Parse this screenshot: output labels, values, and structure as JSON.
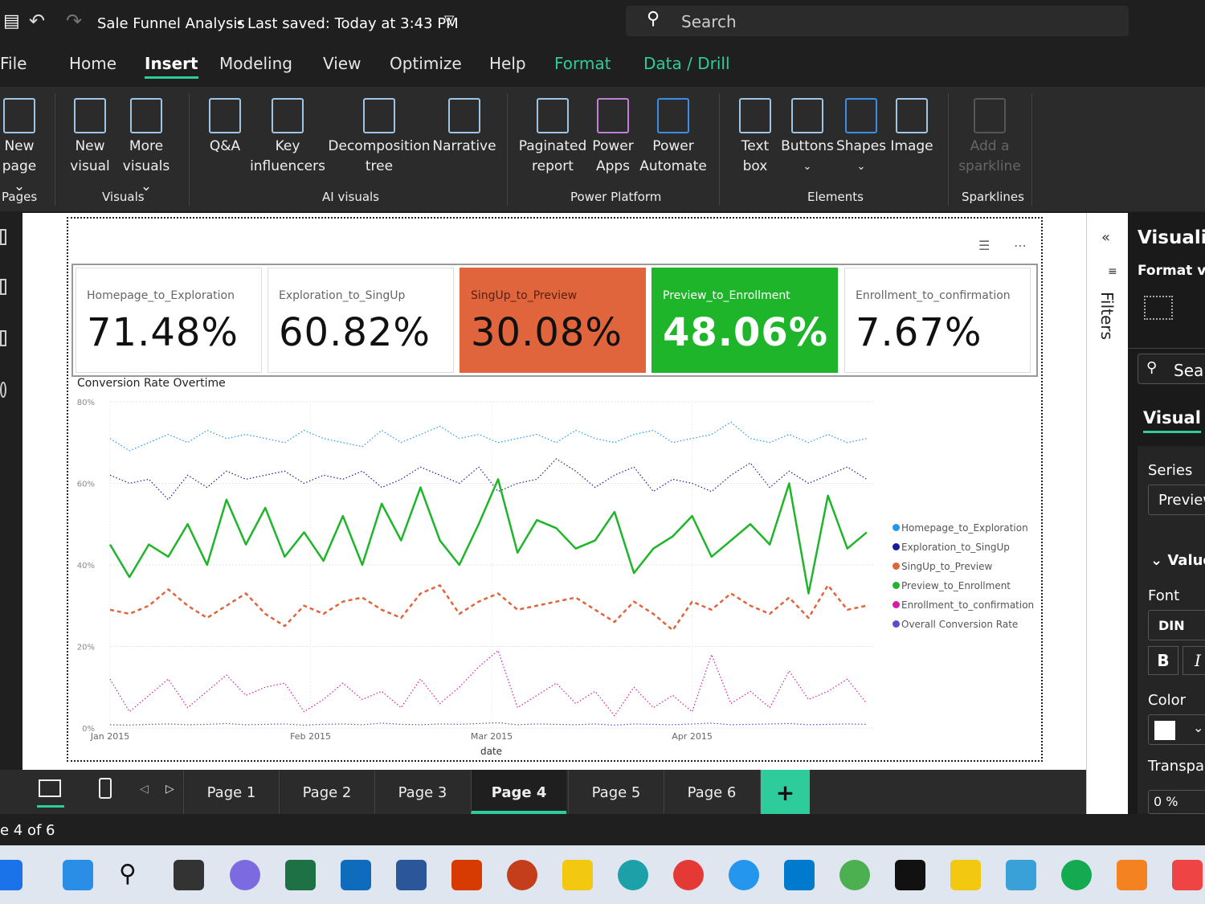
{
  "titlebar": {
    "title": "Sale Funnel Analysis",
    "saved": "Last saved: Today at 3:43 PM",
    "search_placeholder": "Search"
  },
  "menu": [
    "File",
    "Home",
    "Insert",
    "Modeling",
    "View",
    "Optimize",
    "Help",
    "Format",
    "Data / Drill"
  ],
  "ribbon": {
    "buttons": [
      {
        "l1": "New",
        "l2": "page ⌄"
      },
      {
        "l1": "New",
        "l2": "visual"
      },
      {
        "l1": "More",
        "l2": "visuals ⌄"
      },
      {
        "l1": "Q&A",
        "l2": ""
      },
      {
        "l1": "Key",
        "l2": "influencers"
      },
      {
        "l1": "Decomposition",
        "l2": "tree"
      },
      {
        "l1": "Narrative",
        "l2": ""
      },
      {
        "l1": "Paginated",
        "l2": "report"
      },
      {
        "l1": "Power",
        "l2": "Apps"
      },
      {
        "l1": "Power",
        "l2": "Automate"
      },
      {
        "l1": "Text",
        "l2": "box"
      },
      {
        "l1": "Buttons",
        "l2": "⌄"
      },
      {
        "l1": "Shapes",
        "l2": "⌄"
      },
      {
        "l1": "Image",
        "l2": ""
      },
      {
        "l1": "Add a",
        "l2": "sparkline"
      }
    ],
    "groups": [
      "Pages",
      "Visuals",
      "AI visuals",
      "Power Platform",
      "Elements",
      "Sparklines"
    ]
  },
  "cards": [
    {
      "label": "Homepage_to_Exploration",
      "value": "71.48%",
      "bg": "#ffffff",
      "fg": "#111111"
    },
    {
      "label": "Exploration_to_SingUp",
      "value": "60.82%",
      "bg": "#ffffff",
      "fg": "#111111"
    },
    {
      "label": "SingUp_to_Preview",
      "value": "30.08%",
      "bg": "#e0643c",
      "fg": "#111111"
    },
    {
      "label": "Preview_to_Enrollment",
      "value": "48.06%",
      "bg": "#1fb52a",
      "fg": "#ffffff"
    },
    {
      "label": "Enrollment_to_confirmation",
      "value": "7.67%",
      "bg": "#ffffff",
      "fg": "#111111"
    }
  ],
  "chart_data": {
    "type": "line",
    "title": "Conversion Rate Overtime",
    "xlabel": "date",
    "ylabel": "",
    "ylim": [
      0,
      80
    ],
    "yticks": [
      "0%",
      "20%",
      "40%",
      "60%",
      "80%"
    ],
    "xticks": [
      "Jan 2015",
      "Feb 2015",
      "Mar 2015",
      "Apr 2015"
    ],
    "x_range_days": [
      0,
      118
    ],
    "x_step_days": 3,
    "legend_position": "right",
    "series": [
      {
        "name": "Homepage_to_Exploration",
        "color": "#2196f3",
        "style": "dotted",
        "values": [
          71,
          68,
          70,
          72,
          70,
          73,
          71,
          72,
          71,
          70,
          73,
          71,
          70,
          69,
          73,
          70,
          72,
          74,
          71,
          72,
          70,
          71,
          72,
          70,
          73,
          71,
          70,
          72,
          73,
          70,
          71,
          72,
          75,
          71,
          70,
          72,
          70,
          72,
          70,
          71
        ]
      },
      {
        "name": "Exploration_to_SingUp",
        "color": "#1a1a9c",
        "style": "dotted",
        "values": [
          62,
          60,
          61,
          56,
          62,
          59,
          63,
          61,
          62,
          63,
          60,
          62,
          61,
          63,
          59,
          61,
          64,
          62,
          60,
          64,
          58,
          60,
          61,
          66,
          63,
          59,
          62,
          64,
          58,
          61,
          60,
          58,
          62,
          65,
          59,
          63,
          60,
          62,
          64,
          61
        ]
      },
      {
        "name": "SingUp_to_Preview",
        "color": "#e0643c",
        "style": "dashed",
        "values": [
          29,
          28,
          30,
          34,
          30,
          27,
          30,
          33,
          28,
          25,
          30,
          28,
          31,
          32,
          29,
          27,
          33,
          35,
          28,
          31,
          33,
          29,
          30,
          31,
          32,
          29,
          26,
          31,
          28,
          24,
          31,
          29,
          33,
          30,
          28,
          32,
          27,
          35,
          29,
          30
        ]
      },
      {
        "name": "Preview_to_Enrollment",
        "color": "#1fb52a",
        "style": "solid",
        "values": [
          45,
          37,
          45,
          42,
          50,
          40,
          56,
          45,
          54,
          42,
          48,
          41,
          52,
          40,
          55,
          46,
          59,
          46,
          40,
          50,
          61,
          43,
          51,
          49,
          44,
          46,
          53,
          38,
          44,
          47,
          52,
          42,
          46,
          50,
          45,
          60,
          33,
          57,
          44,
          48
        ]
      },
      {
        "name": "Enrollment_to_confirmation",
        "color": "#d81ba0",
        "style": "dotted",
        "values": [
          12,
          4,
          8,
          12,
          5,
          9,
          13,
          8,
          10,
          11,
          4,
          7,
          11,
          7,
          9,
          5,
          12,
          6,
          10,
          15,
          19,
          5,
          8,
          11,
          6,
          9,
          3,
          10,
          5,
          8,
          4,
          18,
          6,
          9,
          5,
          14,
          7,
          9,
          12,
          6
        ]
      },
      {
        "name": "Overall Conversion Rate",
        "color": "#5b4ec9",
        "style": "dotted",
        "values": [
          0.8,
          0.7,
          0.9,
          1,
          0.8,
          0.9,
          1.1,
          0.8,
          0.9,
          1,
          0.7,
          0.9,
          1,
          0.8,
          1.2,
          0.9,
          0.8,
          1,
          0.9,
          1.1,
          1.3,
          0.8,
          1,
          0.9,
          0.8,
          1,
          0.7,
          1,
          0.9,
          0.8,
          1,
          1.2,
          0.8,
          0.9,
          1,
          1.1,
          0.8,
          0.9,
          1,
          0.9
        ]
      }
    ]
  },
  "filters_label": "Filters",
  "viz_pane": {
    "title": "Visualiz",
    "subtitle": "Format vis",
    "search": "Sear",
    "tab": "Visual",
    "series_label": "Series",
    "series_value": "Preview",
    "section": "Value",
    "font_label": "Font",
    "font_value": "DIN",
    "bold": "B",
    "italic": "I",
    "color_label": "Color",
    "transparency_label": "Transpar",
    "transparency_value": "0 %"
  },
  "pages": [
    "Page 1",
    "Page 2",
    "Page 3",
    "Page 4",
    "Page 5",
    "Page 6"
  ],
  "active_page": "Page 4",
  "add_page": "+",
  "status": "e 4 of 6"
}
